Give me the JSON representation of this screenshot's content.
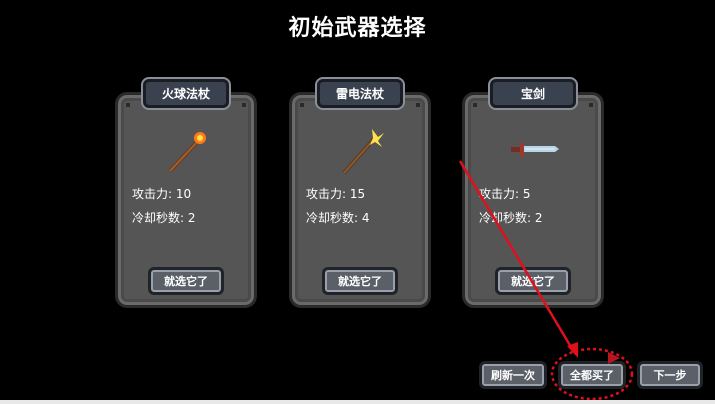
{
  "title": "初始武器选择",
  "cards": [
    {
      "name": "火球法杖",
      "attack_label": "攻击力:",
      "attack": "10",
      "cooldown_label": "冷却秒数:",
      "cooldown": "2",
      "button": "就选它了",
      "icon": "fire-staff-icon"
    },
    {
      "name": "雷电法杖",
      "attack_label": "攻击力:",
      "attack": "15",
      "cooldown_label": "冷却秒数:",
      "cooldown": "4",
      "button": "就选它了",
      "icon": "lightning-staff-icon"
    },
    {
      "name": "宝剑",
      "attack_label": "攻击力:",
      "attack": "5",
      "cooldown_label": "冷却秒数:",
      "cooldown": "2",
      "button": "就选它了",
      "icon": "sword-icon"
    }
  ],
  "bottom": {
    "refresh": "刷新一次",
    "buy_all": "全都买了",
    "next": "下一步"
  },
  "annotation": {
    "arrow_color": "#e0101a",
    "highlight_target": "buy-all-button"
  }
}
